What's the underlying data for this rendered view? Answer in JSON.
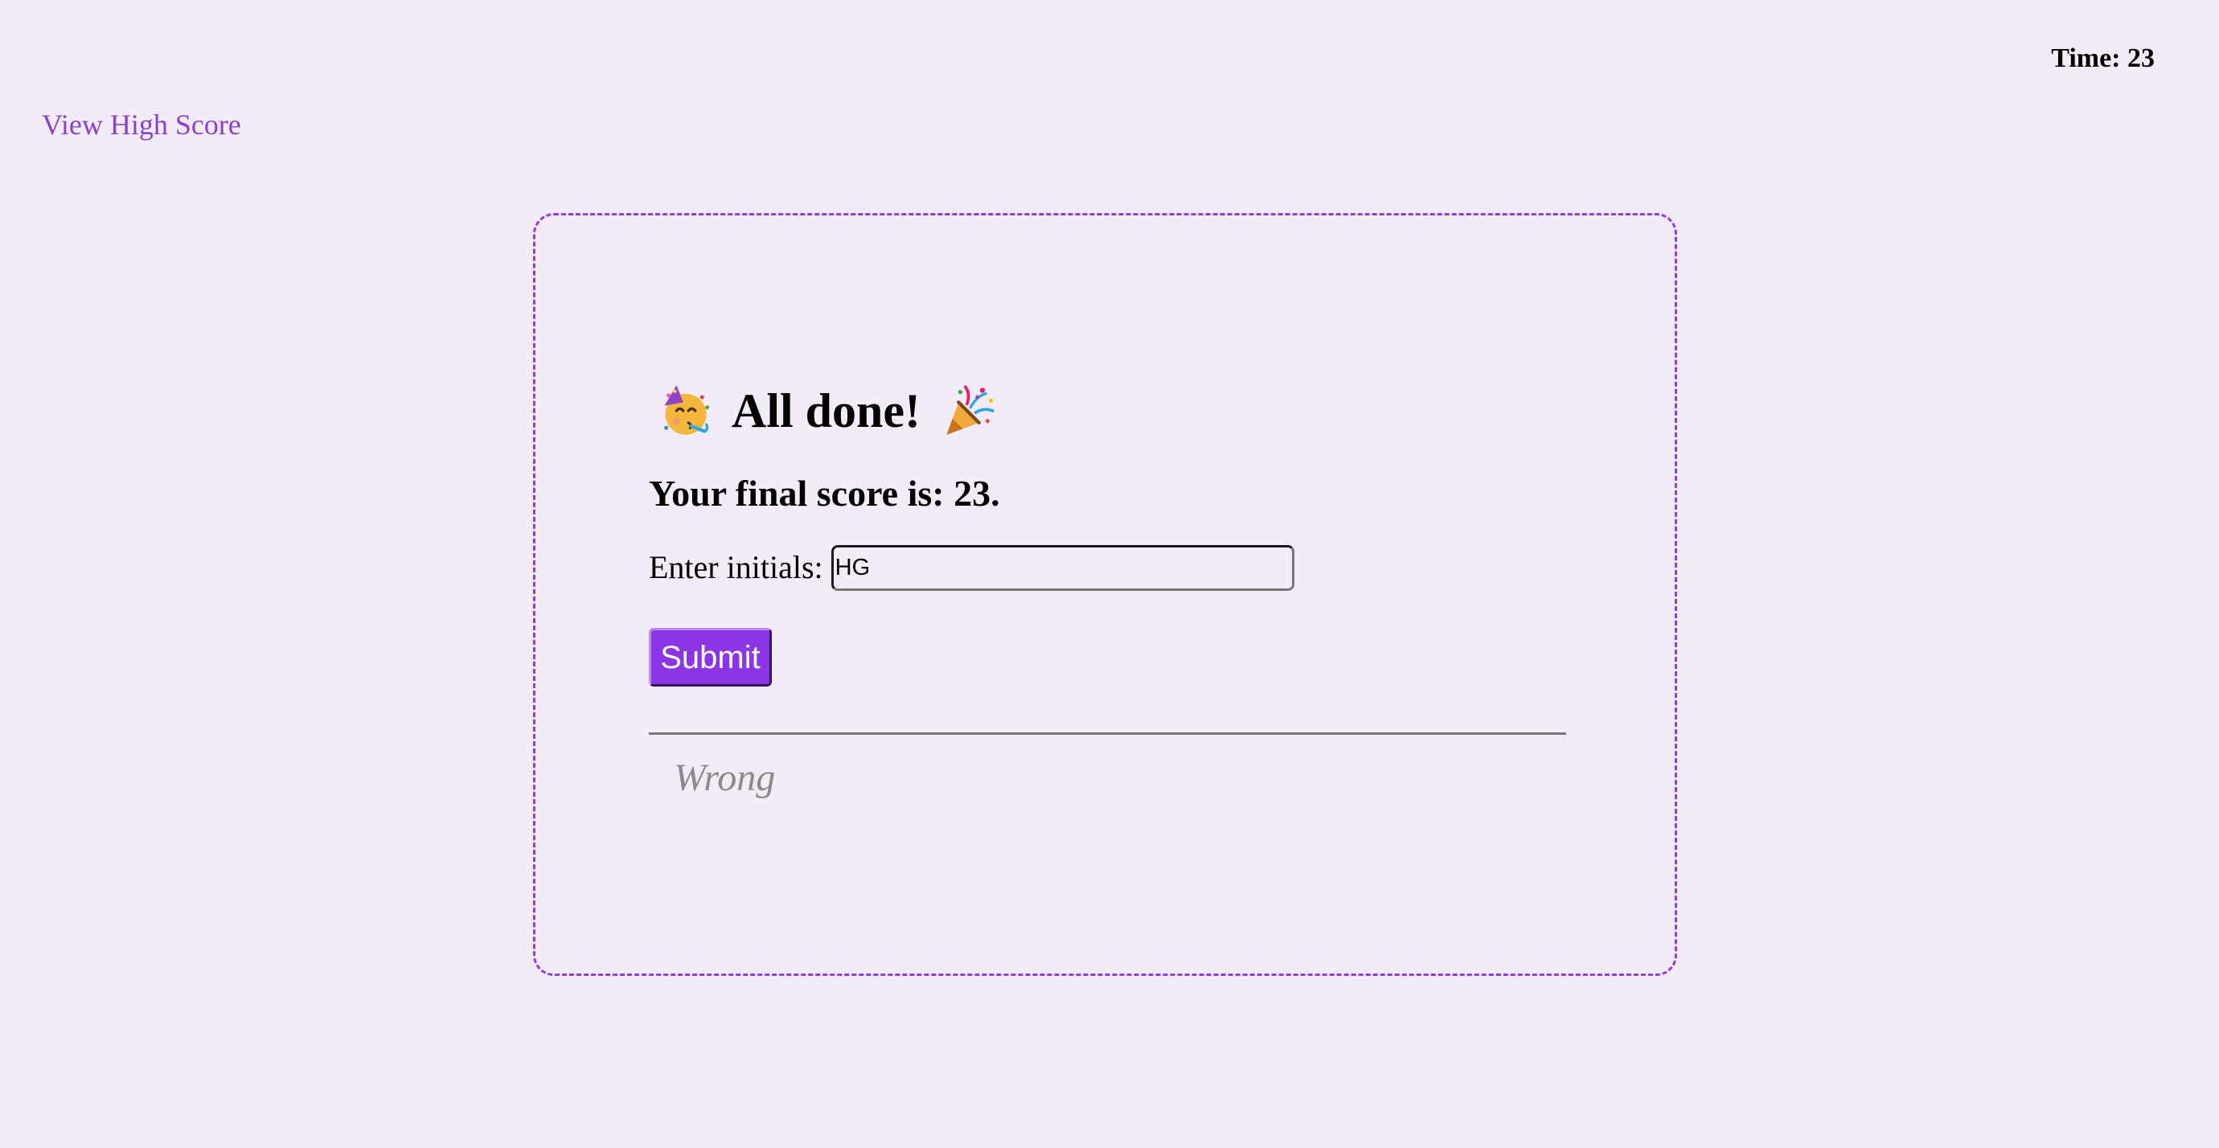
{
  "header": {
    "timer_label": "Time: 23",
    "high_score_link": "View High Score"
  },
  "quiz_end": {
    "title": "All done!",
    "left_icon": "partying-face-icon",
    "right_icon": "party-popper-icon",
    "final_score_text": "Your final score is: 23.",
    "initials_label": "Enter initials:",
    "initials_value": "HG",
    "submit_label": "Submit",
    "feedback_text": "Wrong"
  },
  "colors": {
    "background": "#f3ecf8",
    "accent": "#8b35e6",
    "link": "#8a3fd1",
    "feedback": "#8a8a8a"
  }
}
